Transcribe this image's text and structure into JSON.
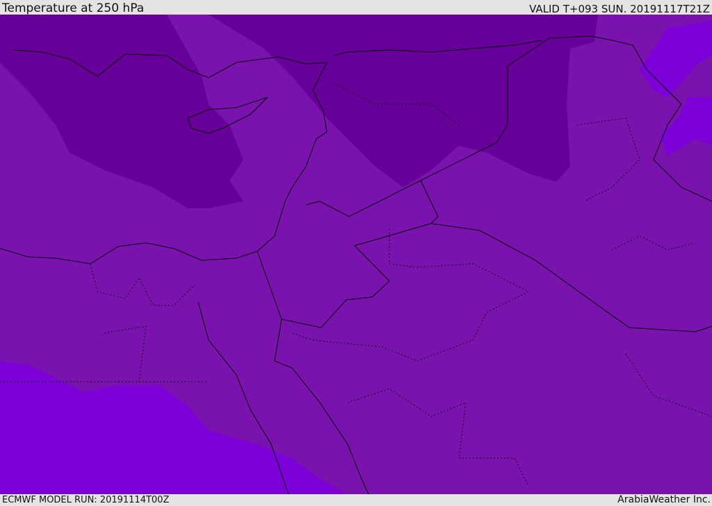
{
  "header": {
    "title": "Temperature at 250 hPa",
    "valid": "VALID T+093 SUN. 20191117T21Z"
  },
  "footer": {
    "model_run": "ECMWF MODEL RUN: 20191114T00Z",
    "credit": "ArabiaWeather Inc."
  },
  "map": {
    "colors": {
      "base": "#7a12ae",
      "cold": "#670099",
      "warm": "#7e00d8",
      "border": "#000000"
    }
  }
}
